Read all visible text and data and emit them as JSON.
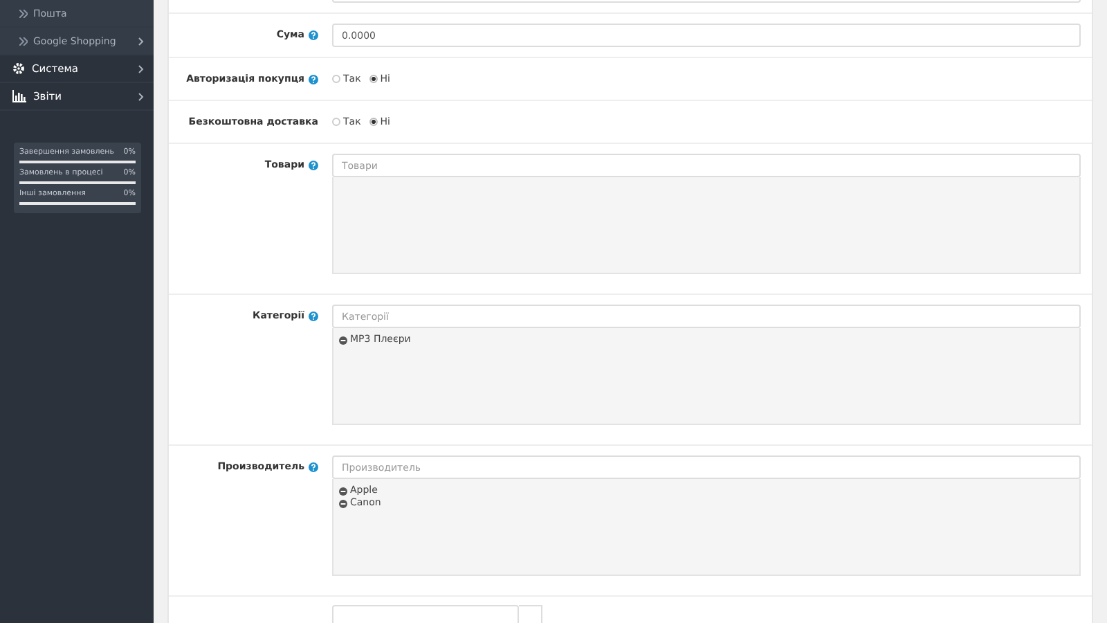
{
  "sidebar": {
    "items": [
      {
        "label": "Пошта",
        "kind": "sub",
        "has_children": false
      },
      {
        "label": "Google Shopping",
        "kind": "sub",
        "has_children": true
      },
      {
        "label": "Система",
        "kind": "gear",
        "has_children": true
      },
      {
        "label": "Звіти",
        "kind": "chart",
        "has_children": true
      }
    ],
    "stats": [
      {
        "label": "Завершення замовлень",
        "reading": "0%",
        "level": 0
      },
      {
        "label": "Замовлень в процесі",
        "reading": "0%",
        "level": 0
      },
      {
        "label": "Інші замовлення",
        "reading": "0%",
        "level": 0
      }
    ]
  },
  "form": [
    {
      "kind": "partial"
    },
    {
      "kind": "input",
      "label": "Сума",
      "help": true,
      "value": "0.0000"
    },
    {
      "kind": "radio",
      "label": "Авторизація покупця",
      "help": true,
      "options": [
        {
          "label": "Так",
          "selected": false
        },
        {
          "label": "Ні",
          "selected": true
        }
      ]
    },
    {
      "kind": "radio",
      "label": "Безкоштовна доставка",
      "help": false,
      "options": [
        {
          "label": "Так",
          "selected": false
        },
        {
          "label": "Ні",
          "selected": true
        }
      ]
    },
    {
      "kind": "autocomplete",
      "label": "Товари",
      "help": true,
      "placeholder": "Товари"
    },
    {
      "kind": "autocomplete",
      "label": "Категорії",
      "help": true,
      "placeholder": "Категорії",
      "items": [
        "MP3 Плеєри"
      ]
    },
    {
      "kind": "autocomplete",
      "label": "Производитель",
      "help": true,
      "placeholder": "Производитель",
      "items": [
        "Apple",
        "Canon"
      ]
    },
    {
      "kind": "date"
    }
  ]
}
